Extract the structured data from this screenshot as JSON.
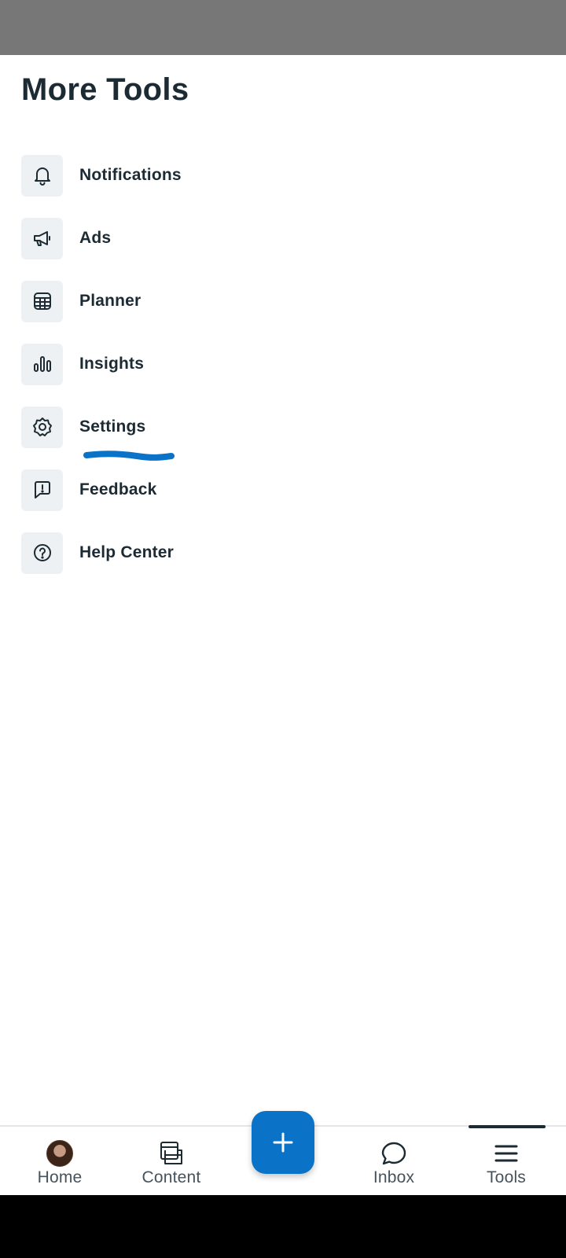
{
  "page": {
    "title": "More Tools"
  },
  "menu": {
    "items": [
      {
        "label": "Notifications",
        "icon": "bell-icon"
      },
      {
        "label": "Ads",
        "icon": "megaphone-icon"
      },
      {
        "label": "Planner",
        "icon": "calendar-grid-icon"
      },
      {
        "label": "Insights",
        "icon": "bar-chart-icon"
      },
      {
        "label": "Settings",
        "icon": "gear-icon"
      },
      {
        "label": "Feedback",
        "icon": "feedback-bubble-icon"
      },
      {
        "label": "Help Center",
        "icon": "question-circle-icon"
      }
    ]
  },
  "bottom_nav": {
    "items": [
      {
        "label": "Home",
        "icon": "avatar"
      },
      {
        "label": "Content",
        "icon": "content-stack-icon"
      },
      {
        "label": "Inbox",
        "icon": "chat-bubble-icon"
      },
      {
        "label": "Tools",
        "icon": "menu-lines-icon",
        "active": true
      }
    ],
    "create_button": {
      "icon": "plus-icon"
    }
  },
  "colors": {
    "accent": "#0a73c8",
    "text": "#1c2b33",
    "icon_bg": "#eef1f4",
    "annotation": "#0a73c8",
    "status_bar": "#777777"
  }
}
